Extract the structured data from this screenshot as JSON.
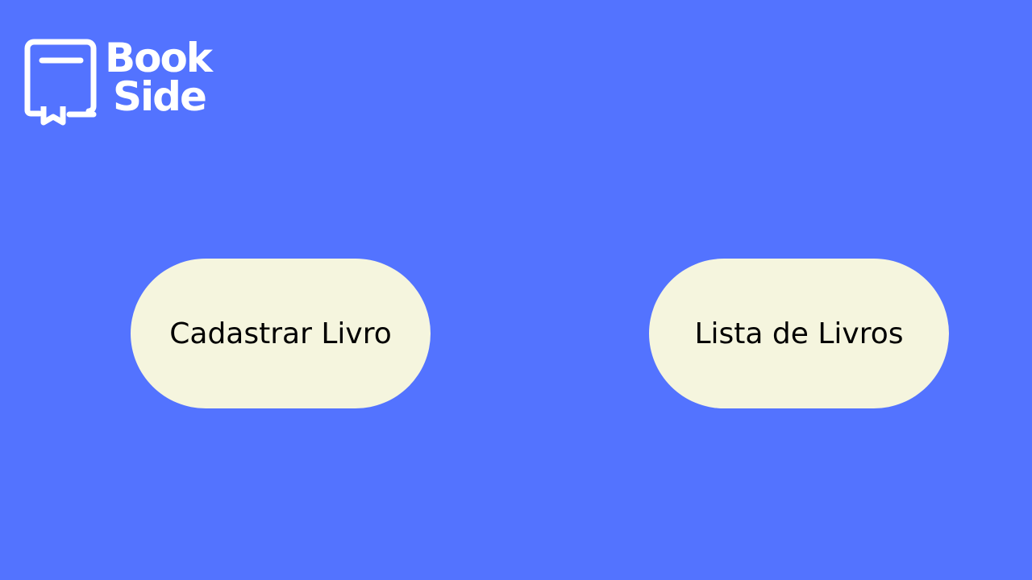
{
  "brand": {
    "line1": "Book",
    "line2": "Side",
    "icon": "book-icon",
    "text_color": "#ffffff"
  },
  "background_color": "#5373ff",
  "actions": {
    "register_label": "Cadastrar Livro",
    "list_label": "Lista de Livros",
    "button_color": "#f5f5de"
  }
}
